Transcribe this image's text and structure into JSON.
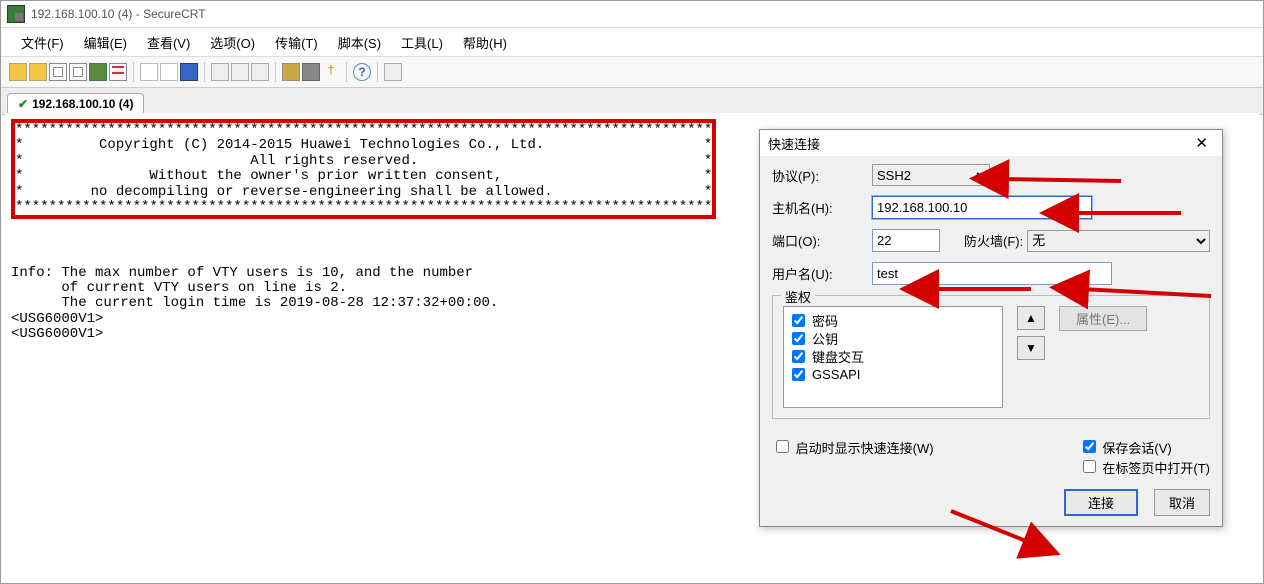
{
  "title": "192.168.100.10 (4) - SecureCRT",
  "menu": [
    "文件(F)",
    "编辑(E)",
    "查看(V)",
    "选项(O)",
    "传输(T)",
    "脚本(S)",
    "工具(L)",
    "帮助(H)"
  ],
  "tab": {
    "label": "192.168.100.10 (4)"
  },
  "terminal_lines": "***********************************************************************************\n*         Copyright (C) 2014-2015 Huawei Technologies Co., Ltd.                   *\n*                           All rights reserved.                                  *\n*               Without the owner's prior written consent,                        *\n*        no decompiling or reverse-engineering shall be allowed.                  *\n***********************************************************************************\n\n\nInfo: The max number of VTY users is 10, and the number\n      of current VTY users on line is 2.\n      The current login time is 2019-08-28 12:37:32+00:00.\n<USG6000V1>\n<USG6000V1>",
  "dialog": {
    "title": "快速连接",
    "protocol_label": "协议(P):",
    "protocol_value": "SSH2",
    "host_label": "主机名(H):",
    "host_value": "192.168.100.10",
    "port_label": "端口(O):",
    "port_value": "22",
    "firewall_label": "防火墙(F):",
    "firewall_value": "无",
    "user_label": "用户名(U):",
    "user_value": "test",
    "auth_legend": "鉴权",
    "auth_items": [
      "密码",
      "公钥",
      "键盘交互",
      "GSSAPI"
    ],
    "props_btn": "属性(E)...",
    "startup": "启动时显示快速连接(W)",
    "save_sess": "保存会话(V)",
    "open_tab": "在标签页中打开(T)",
    "connect": "连接",
    "cancel": "取消"
  }
}
